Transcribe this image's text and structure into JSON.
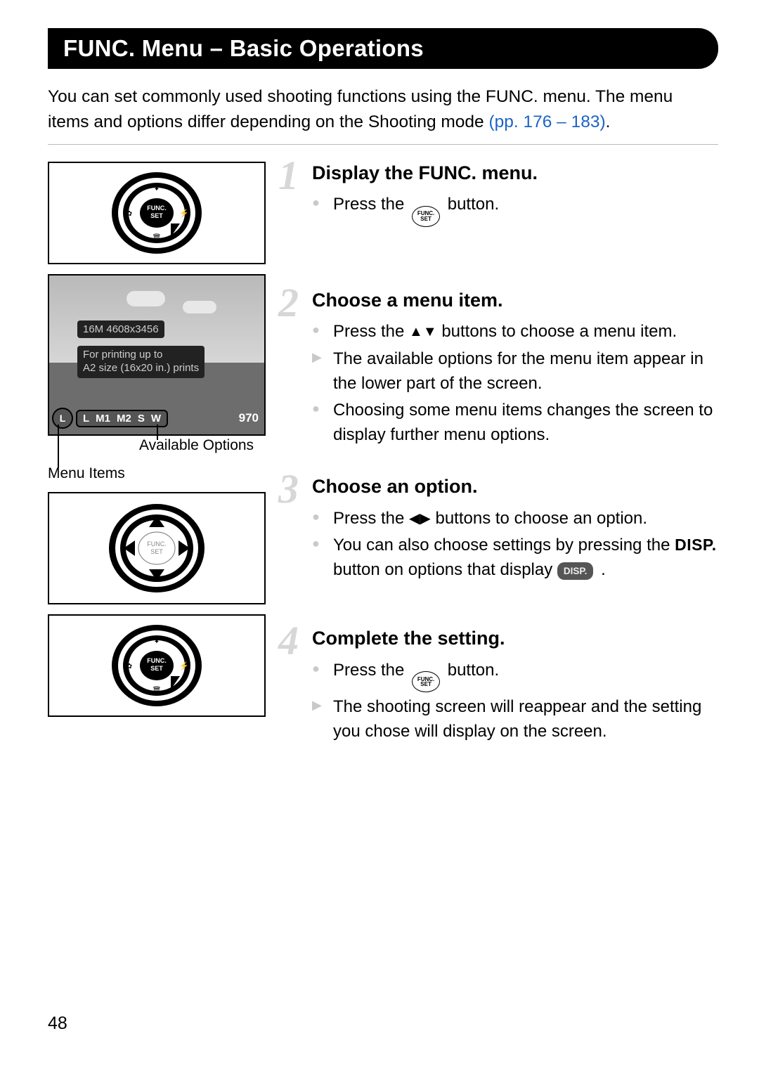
{
  "title": "FUNC. Menu – Basic Operations",
  "intro": {
    "line1": "You can set commonly used shooting functions using the FUNC. menu. The menu items and options differ depending on the Shooting mode ",
    "link": "(pp. 176 – 183)",
    "period": "."
  },
  "screen": {
    "resolution": "16M 4608x3456",
    "print_line1": "For printing up to",
    "print_line2": "A2 size (16x20 in.) prints",
    "bar_L": "L",
    "bar_opts": [
      "L",
      "M1",
      "M2",
      "S",
      "W"
    ],
    "bar_count": "970"
  },
  "captions": {
    "available_options": "Available Options",
    "menu_items": "Menu Items"
  },
  "steps": [
    {
      "num": "1",
      "title": "Display the FUNC. menu.",
      "items": [
        {
          "kind": "dot",
          "pre": "Press the ",
          "icon": "funcset",
          "post": " button."
        }
      ]
    },
    {
      "num": "2",
      "title": "Choose a menu item.",
      "items": [
        {
          "kind": "dot",
          "pre": "Press the ",
          "icon": "updown",
          "post": " buttons to choose a menu item."
        },
        {
          "kind": "tri",
          "text": "The available options for the menu item appear in the lower part of the screen."
        },
        {
          "kind": "dot",
          "text": "Choosing some menu items changes the screen to display further menu options."
        }
      ]
    },
    {
      "num": "3",
      "title": "Choose an option.",
      "items": [
        {
          "kind": "dot",
          "pre": "Press the ",
          "icon": "leftright",
          "post": " buttons to choose an option."
        },
        {
          "kind": "dot",
          "pre": "You can also choose settings by pressing the ",
          "icon": "disp",
          "post": " button on options that display ",
          "trail_icon": "disppill",
          "period": " ."
        }
      ]
    },
    {
      "num": "4",
      "title": "Complete the setting.",
      "items": [
        {
          "kind": "dot",
          "pre": "Press the ",
          "icon": "funcset",
          "post": " button."
        },
        {
          "kind": "tri",
          "text": "The shooting screen will reappear and the setting you chose will display on the screen."
        }
      ]
    }
  ],
  "icons": {
    "funcset_top": "FUNC.",
    "funcset_bot": "SET",
    "disp_text": "DISP.",
    "disp_pill": "DISP."
  },
  "page_number": "48"
}
